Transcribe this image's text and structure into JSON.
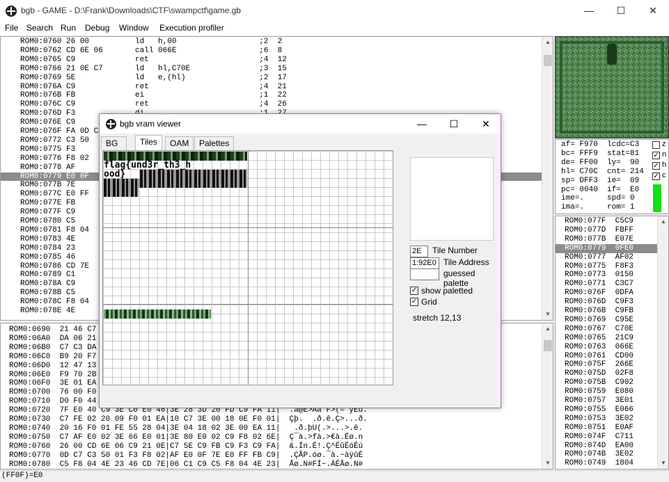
{
  "window": {
    "title": "bgb - GAME - D:\\Frank\\Downloads\\CTF\\swampctf\\game.gb",
    "min": "—",
    "max": "☐",
    "close": "✕"
  },
  "menu": [
    "File",
    "Search",
    "Run",
    "Debug",
    "Window",
    "Execution profiler"
  ],
  "disasm": [
    "ROM0:0760 26 00          ld   h,00                  ;2  2",
    "ROM0:0762 CD 6E 06       call 066E                  ;6  8",
    "ROM0:0765 C9             ret                        ;4  12",
    "ROM0:0766 21 0E C7       ld   hl,C70E               ;3  15",
    "ROM0:0769 5E             ld   e,(hl)                ;2  17",
    "ROM0:076A C9             ret                        ;4  21",
    "ROM0:076B FB             ei                         ;1  22",
    "ROM0:076C C9             ret                        ;4  26",
    "ROM0:076D F3             di                         ;1  27",
    "ROM0:076E C9",
    "ROM0:076F FA 0D C",
    "ROM0:0772 C3 50",
    "ROM0:0775 F3",
    "ROM0:0776 F8 02",
    "ROM0:0778 AF",
    "ROM0:0779 E0 0F",
    "ROM0:077B 7E",
    "ROM0:077C E0 FF",
    "ROM0:077E FB",
    "ROM0:077F C9",
    "ROM0:0780 C5",
    "ROM0:0781 F8 04",
    "ROM0:0783 4E",
    "ROM0:0784 23",
    "ROM0:0785 46",
    "ROM0:0786 CD 7E",
    "ROM0:0789 C1",
    "ROM0:078A C9",
    "ROM0:078B C5",
    "ROM0:078C F8 04",
    "ROM0:078E 4E"
  ],
  "disasm_selected": 15,
  "hexdump": [
    "ROM0:0690  21 46 C7",
    "ROM0:06A0  DA 06 21",
    "ROM0:06B0  C7 C3 DA",
    "ROM0:06C0  B9 20 F7",
    "ROM0:06D0  12 47 13",
    "ROM0:06E0  F9 70 2B",
    "ROM0:06F0  3E 01 EA",
    "ROM0:0700  76 00 F0",
    "ROM0:0710  D0 F0 44",
    "ROM0:0720  7F E0 40 C9 3E C0 E0 46|3E 28 3D 20 FD C9 FA 11|  .à@E>Aà F>(= ýEú.",
    "ROM0:0730  C7 FE 02 20 09 F0 01 EA|10 C7 3E 00 18 0E F0 01|  Çþ.  .ð.ê.Ç>...ð.",
    "ROM0:0740  20 16 F0 01 FE 55 28 04|3E 04 18 02 3E 00 EA 11|   .ð.þU(.>...>.ê.",
    "ROM0:0750  C7 AF E0 02 3E 66 E0 01|3E 80 E0 02 C9 F8 02 6E|  Ç¯à.>fà.>€à.Éø.n",
    "ROM0:0760  26 00 CD 6E 06 C9 21 0E|C7 5E C9 FB C9 F3 C9 FA|  &.Ín.É!.Ç^ÉûÉóÉú",
    "ROM0:0770  0D C7 C3 50 01 F3 F8 02|AF E0 0F 7E E0 FF FB C9|  .ÇÃP.óø.¯à.~àÿûÉ",
    "ROM0:0780  C5 F8 04 4E 23 46 CD 7E|06 C1 C9 C5 F8 04 4E 23|  Åø.N#FÍ~.ÁÉÅø.N#"
  ],
  "registers": [
    "af= F970  lcdc=C3",
    "bc= FFF9  stat=81",
    "de= FF00  ly=  90",
    "hl= C70C  cnt= 214",
    "sp= DFF3  ie=  09",
    "pc= 0040  if=  E0",
    "ime=.     spd= 0",
    "ima=.     rom= 1"
  ],
  "flags": [
    "z",
    "n",
    "h",
    "c"
  ],
  "stack": [
    "ROM0:077F  C5C9",
    "ROM0:077D  FBFF",
    "ROM0:077B  E07E",
    "ROM0:0779  0FE0",
    "ROM0:0777  AF02",
    "ROM0:0775  F8F3",
    "ROM0:0773  0150",
    "ROM0:0771  C3C7",
    "ROM0:076F  0DFA",
    "ROM0:076D  C9F3",
    "ROM0:076B  C9FB",
    "ROM0:0769  C95E",
    "ROM0:0767  C70E",
    "ROM0:0765  21C9",
    "ROM0:0763  066E",
    "ROM0:0761  CD00",
    "ROM0:075F  266E",
    "ROM0:075D  02F8",
    "ROM0:075B  C902",
    "ROM0:0759  E080",
    "ROM0:0757  3E01",
    "ROM0:0755  E066",
    "ROM0:0753  3E02",
    "ROM0:0751  E0AF",
    "ROM0:074F  C711",
    "ROM0:074D  EA00",
    "ROM0:074B  3E02",
    "ROM0:0749  1804"
  ],
  "stack_selected": 3,
  "status": "(FF0F)=E0",
  "vram": {
    "title": "bgb vram viewer",
    "tabs": [
      "BG map",
      "Tiles",
      "OAM",
      "Palettes"
    ],
    "active_tab": 1,
    "tile_rows": [
      "flag{und3r_th3_h",
      "ood}"
    ],
    "tile_number": "2E",
    "tile_number_label": "Tile Number",
    "tile_address": "1:92E0",
    "tile_address_label": "Tile Address",
    "guessed_palette_label": "guessed palette",
    "show_paletted_label": "show paletted",
    "grid_label": "Grid",
    "stretch": "stretch 12,13"
  }
}
